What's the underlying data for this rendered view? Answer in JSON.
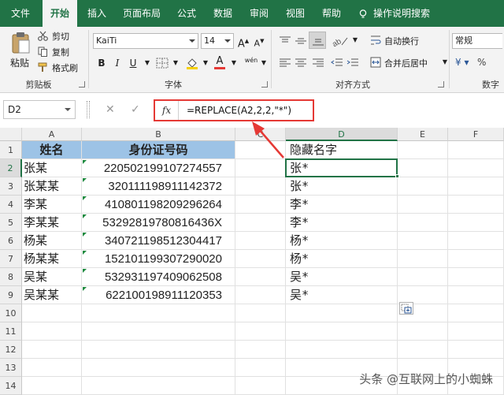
{
  "tabs": [
    "文件",
    "开始",
    "插入",
    "页面布局",
    "公式",
    "数据",
    "审阅",
    "视图",
    "帮助",
    "操作说明搜索"
  ],
  "ribbon": {
    "clipboard": {
      "paste": "粘贴",
      "cut": "剪切",
      "copy": "复制",
      "format_painter": "格式刷",
      "group_label": "剪贴板"
    },
    "font": {
      "font_name": "KaiTi",
      "font_size": "14",
      "grow": "A",
      "shrink": "A",
      "bold": "B",
      "italic": "I",
      "underline": "U",
      "font_color_letter": "A",
      "phonetic": "wén",
      "group_label": "字体"
    },
    "alignment": {
      "wrap_text": "自动换行",
      "merge_center": "合并后居中",
      "group_label": "对齐方式"
    },
    "number": {
      "format": "常规",
      "group_label": "数字"
    }
  },
  "formula_bar": {
    "name_box": "D2",
    "cancel": "✕",
    "enter": "✓",
    "fx": "fx",
    "formula": "=REPLACE(A2,2,2,\"*\")"
  },
  "sheet": {
    "columns": [
      "A",
      "B",
      "C",
      "D",
      "E",
      "F"
    ],
    "rows": [
      "1",
      "2",
      "3",
      "4",
      "5",
      "6",
      "7",
      "8",
      "9",
      "10",
      "11",
      "12",
      "13",
      "14"
    ],
    "header_name": "姓名",
    "header_id": "身份证号码",
    "header_hidden": "隐藏名字",
    "data": [
      {
        "name": "张某",
        "id": "220502199107274557",
        "hidden": "张*"
      },
      {
        "name": "张某某",
        "id": "320111198911142372",
        "hidden": "张*"
      },
      {
        "name": "李某",
        "id": "410801198209296264",
        "hidden": "李*"
      },
      {
        "name": "李某某",
        "id": "53292819780816436X",
        "hidden": "李*"
      },
      {
        "name": "杨某",
        "id": "340721198512304417",
        "hidden": "杨*"
      },
      {
        "name": "杨某某",
        "id": "152101199307290020",
        "hidden": "杨*"
      },
      {
        "name": "吴某",
        "id": "532931197409062508",
        "hidden": "吴*"
      },
      {
        "name": "吴某某",
        "id": "622100198911120353",
        "hidden": "吴*"
      }
    ]
  },
  "watermark": "头条 @互联网上的小蜘蛛",
  "colors": {
    "accent": "#217346",
    "header_fill": "#9dc3e6",
    "highlight": "#e53935"
  }
}
